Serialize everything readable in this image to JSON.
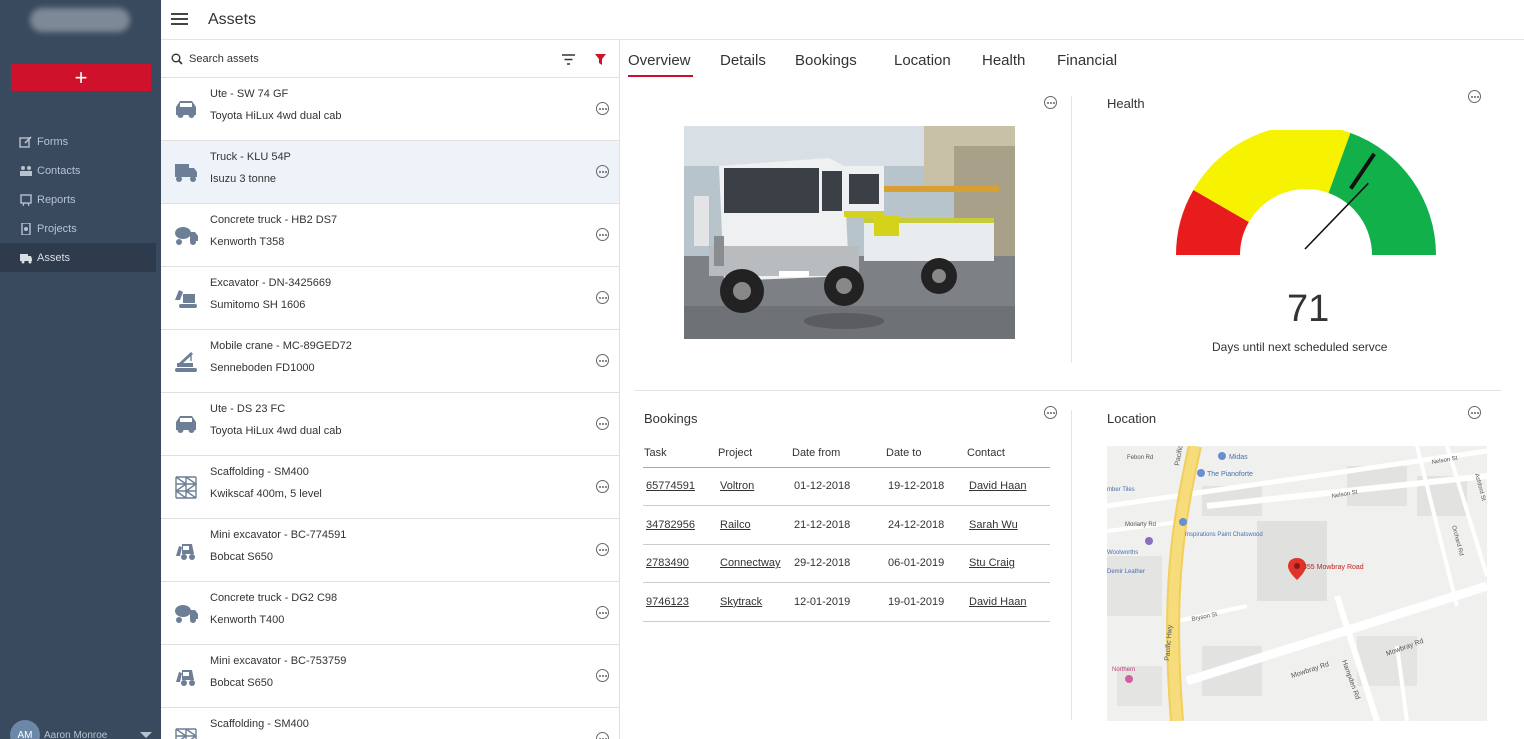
{
  "sidebar": {
    "add_label": "+",
    "items": [
      {
        "label": "Forms",
        "icon": "forms-icon"
      },
      {
        "label": "Contacts",
        "icon": "contacts-icon"
      },
      {
        "label": "Reports",
        "icon": "reports-icon"
      },
      {
        "label": "Projects",
        "icon": "projects-icon"
      },
      {
        "label": "Assets",
        "icon": "assets-icon",
        "active": true
      }
    ],
    "user": {
      "initials": "AM",
      "name": "Aaron Monroe"
    }
  },
  "header": {
    "title": "Assets"
  },
  "search": {
    "placeholder": "Search assets"
  },
  "assets": [
    {
      "title": "Ute - SW 74 GF",
      "subtitle": "Toyota HiLux 4wd dual cab",
      "icon": "ute-icon"
    },
    {
      "title": "Truck - KLU 54P",
      "subtitle": "Isuzu 3 tonne",
      "icon": "truck-icon",
      "selected": true
    },
    {
      "title": "Concrete truck - HB2 DS7",
      "subtitle": "Kenworth T358",
      "icon": "concrete-truck-icon"
    },
    {
      "title": "Excavator - DN-3425669",
      "subtitle": "Sumitomo SH 1606",
      "icon": "excavator-icon"
    },
    {
      "title": "Mobile crane - MC-89GED72",
      "subtitle": "Senneboden FD1000",
      "icon": "crane-icon"
    },
    {
      "title": "Ute - DS 23 FC",
      "subtitle": "Toyota HiLux 4wd dual cab",
      "icon": "ute-icon"
    },
    {
      "title": "Scaffolding - SM400",
      "subtitle": "Kwikscaf 400m, 5 level",
      "icon": "scaffolding-icon"
    },
    {
      "title": "Mini excavator - BC-774591",
      "subtitle": "Bobcat S650",
      "icon": "mini-excavator-icon"
    },
    {
      "title": "Concrete truck - DG2 C98",
      "subtitle": "Kenworth T400",
      "icon": "concrete-truck-icon"
    },
    {
      "title": "Mini excavator - BC-753759",
      "subtitle": "Bobcat S650",
      "icon": "mini-excavator-icon"
    },
    {
      "title": "Scaffolding - SM400",
      "subtitle": "",
      "icon": "scaffolding-icon"
    }
  ],
  "tabs": [
    "Overview",
    "Details",
    "Bookings",
    "Location",
    "Health",
    "Financial"
  ],
  "health": {
    "title": "Health",
    "value": "71",
    "caption": "Days until next scheduled servce",
    "colors": {
      "red": "#e81c1c",
      "yellow": "#f6f200",
      "green": "#12b04a"
    }
  },
  "bookings": {
    "title": "Bookings",
    "columns": [
      "Task",
      "Project",
      "Date from",
      "Date to",
      "Contact"
    ],
    "rows": [
      [
        "65774591",
        "Voltron",
        "01-12-2018",
        "19-12-2018",
        "David Haan"
      ],
      [
        "34782956",
        "Railco",
        "21-12-2018",
        "24-12-2018",
        "Sarah Wu"
      ],
      [
        "2783490",
        "Connectway",
        "29-12-2018",
        "06-01-2019",
        "Stu Craig"
      ],
      [
        "9746123",
        "Skytrack",
        "12-01-2019",
        "19-01-2019",
        "David Haan"
      ]
    ]
  },
  "location": {
    "title": "Location",
    "pin_label": "355 Mowbray Road",
    "street_labels": [
      "Pacific Hwy",
      "Mowbray Rd",
      "Nelson St",
      "Hampden Rd",
      "Bryson St",
      "Moriarty Rd",
      "Febon Rd",
      "Orchard Rd",
      "Ashford St"
    ],
    "poi_labels": [
      "Midas",
      "The Pianoforte",
      "Inspirations Paint Chatswood",
      "Woolworths",
      "Demir Leather",
      "Northern",
      "mber Tiles"
    ]
  },
  "accent": "#c8102e"
}
